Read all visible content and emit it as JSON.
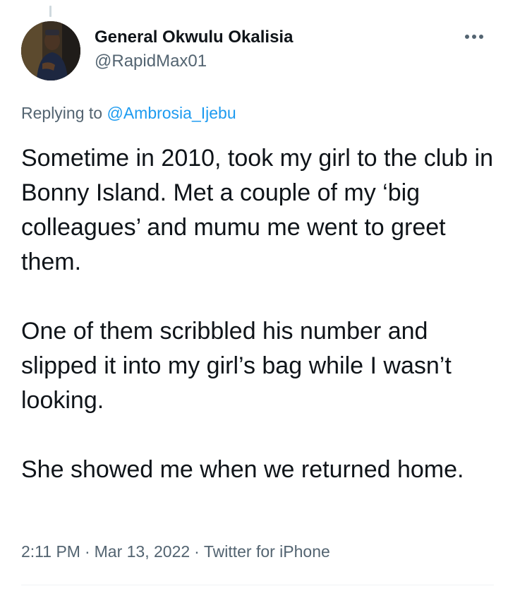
{
  "tweet": {
    "author": {
      "display_name": "General Okwulu Okalisia",
      "handle": "@RapidMax01"
    },
    "replying_to": {
      "prefix": "Replying to",
      "mention": "@Ambrosia_Ijebu"
    },
    "paragraphs": [
      "Sometime in 2010, took my girl to the club in Bonny Island. Met a couple of my ‘big colleagues’ and mumu me went to greet them.",
      "One of them scribbled his number and slipped it into my girl’s bag while I wasn’t looking.",
      "She showed me when we returned home."
    ],
    "meta": {
      "time": "2:11 PM",
      "separator": "·",
      "date": "Mar 13, 2022",
      "source": "Twitter for iPhone"
    }
  },
  "icons": {
    "more": "more-horizontal-icon",
    "avatar": "profile-photo"
  },
  "colors": {
    "text_primary": "#0f1419",
    "text_secondary": "#536471",
    "link": "#1d9bf0",
    "divider": "#eff3f4"
  }
}
